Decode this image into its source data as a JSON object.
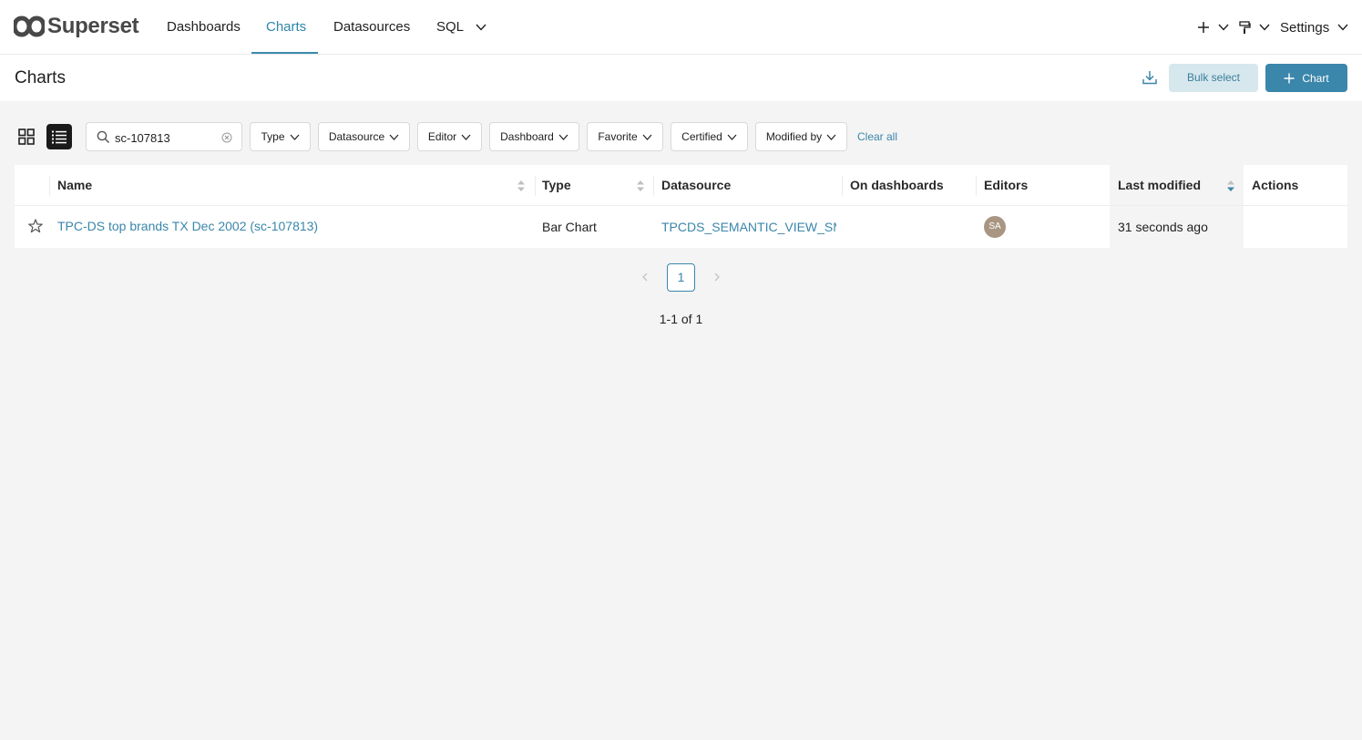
{
  "brand": {
    "name": "Superset",
    "accent": "#3b86ab",
    "logo_color": "#484848"
  },
  "nav": {
    "items": [
      {
        "label": "Dashboards",
        "active": false
      },
      {
        "label": "Charts",
        "active": true
      },
      {
        "label": "Datasources",
        "active": false
      },
      {
        "label": "SQL",
        "active": false,
        "has_dropdown": true
      }
    ],
    "right": {
      "plus_icon": "plus-icon",
      "theme_icon": "paint-roller-icon",
      "settings_label": "Settings"
    }
  },
  "header": {
    "title": "Charts",
    "bulk_select_label": "Bulk select",
    "add_chart_label": "Chart"
  },
  "filters": {
    "search_value": "sc-107813",
    "items": [
      "Type",
      "Datasource",
      "Editor",
      "Dashboard",
      "Favorite",
      "Certified",
      "Modified by"
    ],
    "clear_all_label": "Clear all"
  },
  "table": {
    "columns": [
      "Name",
      "Type",
      "Datasource",
      "On dashboards",
      "Editors",
      "Last modified",
      "Actions"
    ],
    "sorted_column": "Last modified",
    "rows": [
      {
        "name": "TPC-DS top brands TX Dec 2002 (sc-107813)",
        "type": "Bar Chart",
        "datasource": "TPCDS_SEMANTIC_VIEW_SM",
        "on_dashboards": "",
        "editor_initials": "SA",
        "last_modified": "31 seconds ago",
        "favorite": false
      }
    ]
  },
  "pagination": {
    "current_page": "1",
    "summary": "1-1 of 1"
  }
}
